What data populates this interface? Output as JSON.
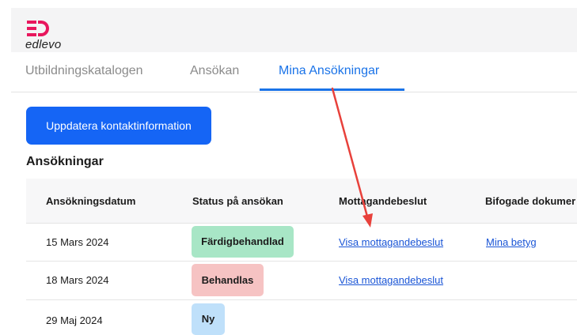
{
  "brand": {
    "logo_text": "edlevo",
    "logo_color": "#e8175d"
  },
  "tabs": [
    {
      "label": "Utbildningskatalogen",
      "active": false
    },
    {
      "label": "Ansökan",
      "active": false
    },
    {
      "label": "Mina Ansökningar",
      "active": true
    }
  ],
  "actions": {
    "update_contact": "Uppdatera kontaktinformation"
  },
  "applications": {
    "title": "Ansökningar",
    "columns": [
      "Ansökningsdatum",
      "Status på ansökan",
      "Mottagandebeslut",
      "Bifogade dokumer"
    ],
    "rows": [
      {
        "date": "15 Mars 2024",
        "status": "Färdigbehandlad",
        "status_color": "#a8e6c6",
        "decision_link": "Visa mottagandebeslut",
        "attachment_link": "Mina betyg"
      },
      {
        "date": "18 Mars 2024",
        "status": "Behandlas",
        "status_color": "#f6c3c3",
        "decision_link": "Visa mottagandebeslut",
        "attachment_link": ""
      },
      {
        "date": "29 Maj 2024",
        "status": "Ny",
        "status_color": "#bfe0fa",
        "decision_link": "",
        "attachment_link": ""
      }
    ]
  },
  "colors": {
    "accent": "#1a73e8",
    "button": "#1565f5",
    "annotation_arrow": "#e8413b"
  }
}
